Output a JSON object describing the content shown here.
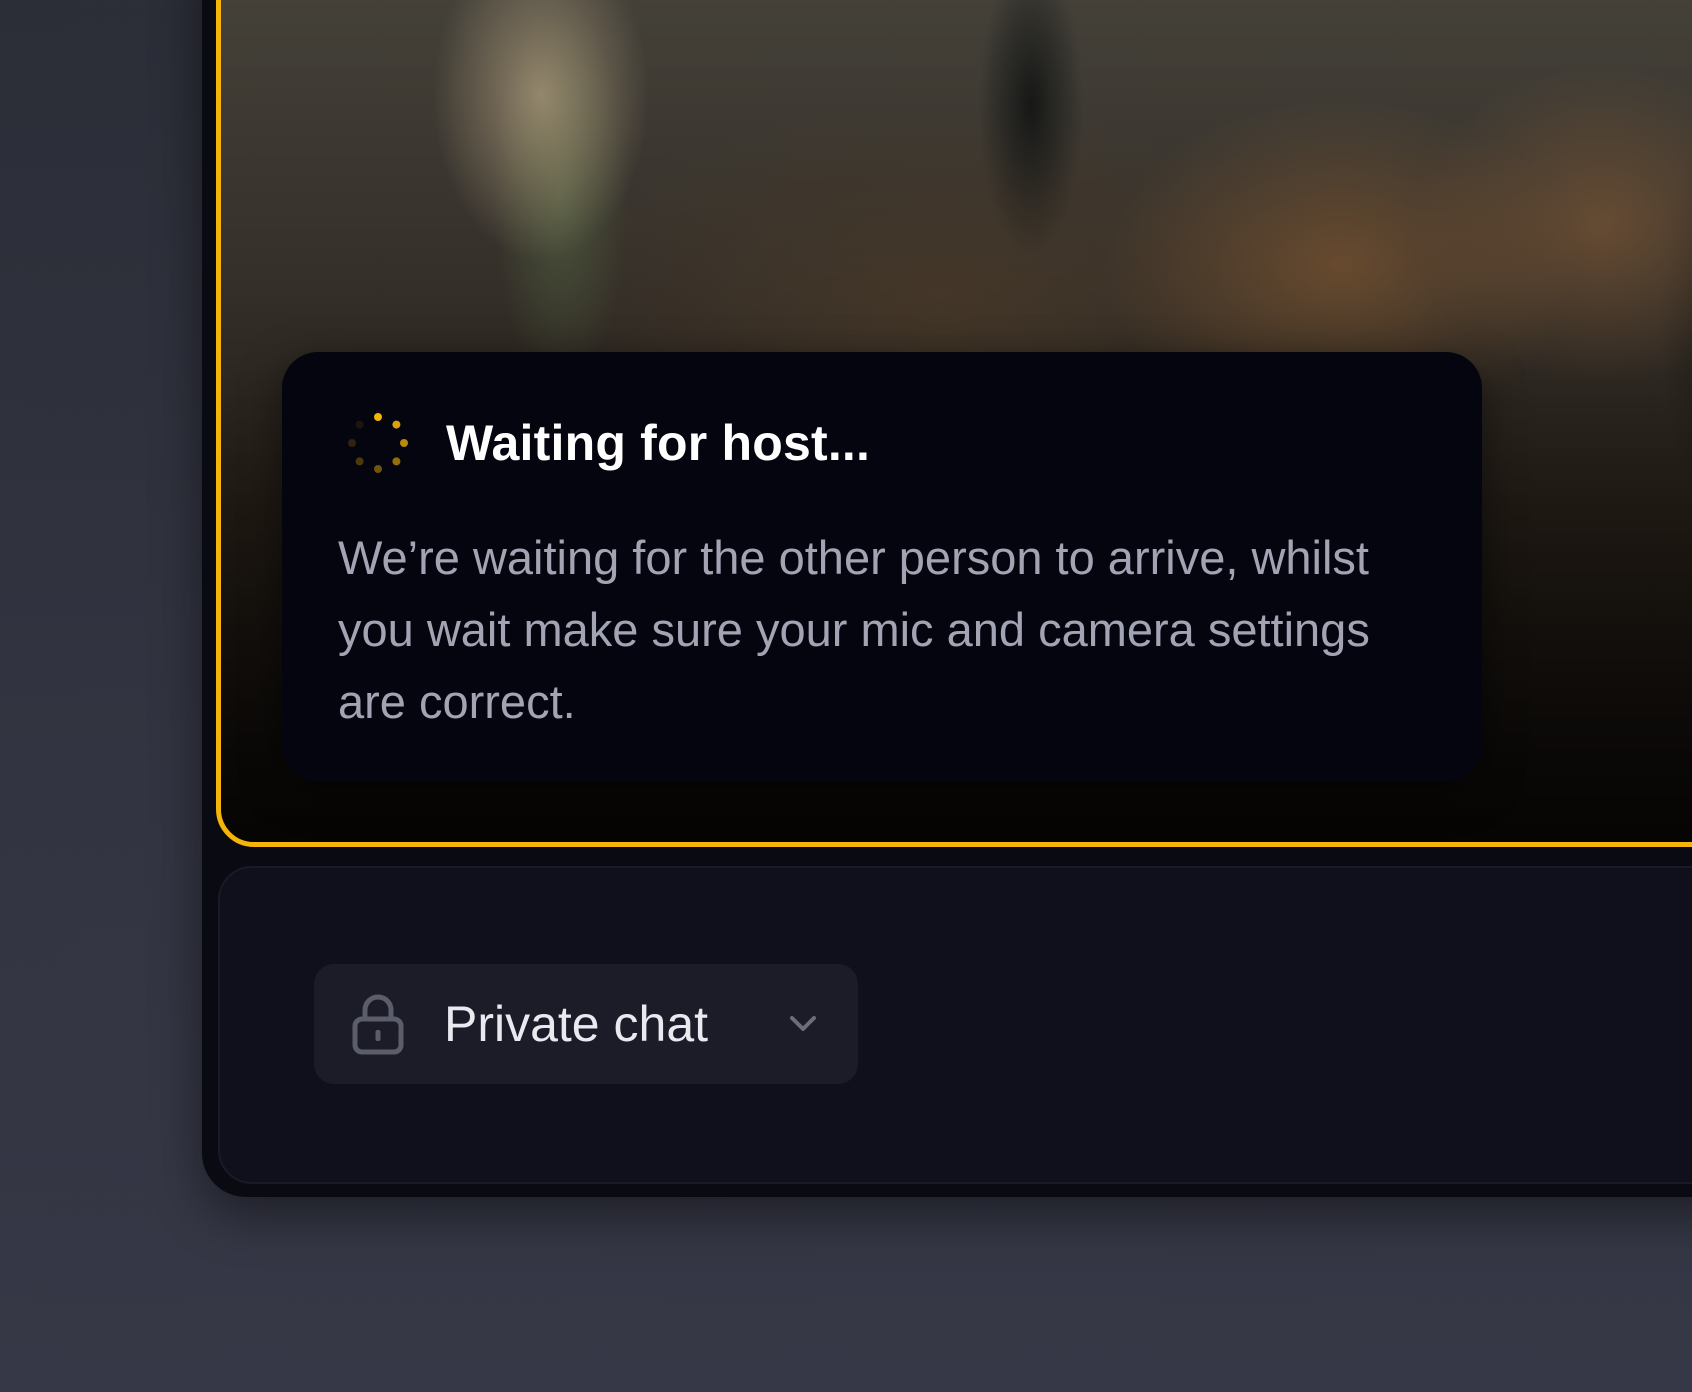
{
  "waiting_card": {
    "title": "Waiting for host...",
    "message": "We’re waiting for the other person to arrive, whilst you wait make sure your mic and camera settings are correct.",
    "spinner_icon": "loading-spinner-icon"
  },
  "controls": {
    "privacy_dropdown": {
      "label": "Private chat",
      "leading_icon": "lock-icon",
      "trailing_icon": "chevron-down-icon"
    }
  },
  "colors": {
    "accent": "#f5b40a",
    "card_background": "#050510",
    "controls_background": "#0f101b",
    "dropdown_background": "#1b1c28",
    "page_background": "#2f313d"
  }
}
